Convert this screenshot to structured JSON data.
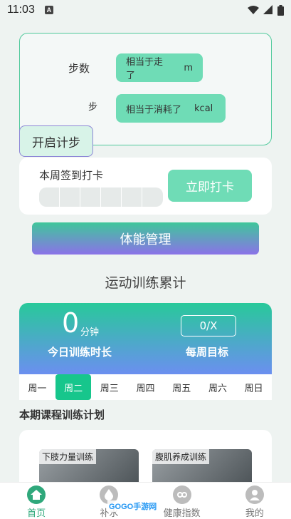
{
  "status_bar": {
    "time": "11:03",
    "notification_letter": "A"
  },
  "step_card": {
    "steps_label": "步数",
    "step_unit_label": "步",
    "distance_text": "相当于走了",
    "distance_unit": "m",
    "calorie_text": "相当于消耗了",
    "calorie_unit": "kcal",
    "start_button": "开启计步"
  },
  "checkin": {
    "title": "本周签到打卡",
    "button": "立即打卡",
    "days_checked": 0,
    "days_total": 6
  },
  "fitness_button": "体能管理",
  "training": {
    "section_title": "运动训练累计",
    "minutes": "0",
    "minutes_unit": "分钟",
    "today_label": "今日训练时长",
    "weekly_goal_value": "0/X",
    "weekly_goal_label": "每周目标"
  },
  "week": {
    "days": [
      "周一",
      "周二",
      "周三",
      "周四",
      "周五",
      "周六",
      "周日"
    ],
    "selected": "周二"
  },
  "plan": {
    "title": "本期课程训练计划",
    "courses": [
      "下肢力量训练",
      "腹肌养成训练"
    ]
  },
  "tabbar": {
    "items": [
      {
        "label": "首页",
        "icon": "home-icon",
        "active": true
      },
      {
        "label": "补水",
        "icon": "water-drop-icon",
        "active": false
      },
      {
        "label": "健康指数",
        "icon": "health-index-icon",
        "active": false
      },
      {
        "label": "我的",
        "icon": "profile-icon",
        "active": false
      }
    ]
  },
  "watermark": "GOGO手游网",
  "colors": {
    "accent": "#6fdcb6",
    "active_green": "#17c68c",
    "tab_active": "#2fa87b",
    "gradient_end": "#8b72e8"
  }
}
